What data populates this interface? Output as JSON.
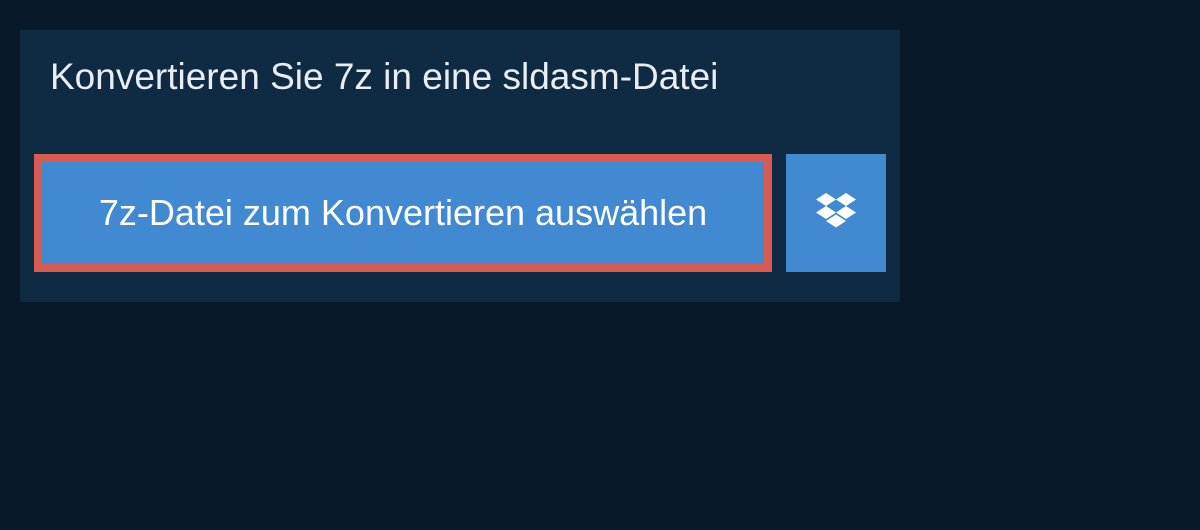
{
  "header": {
    "title": "Konvertieren Sie 7z in eine sldasm-Datei"
  },
  "actions": {
    "select_file_label": "7z-Datei zum Konvertieren auswählen"
  }
}
